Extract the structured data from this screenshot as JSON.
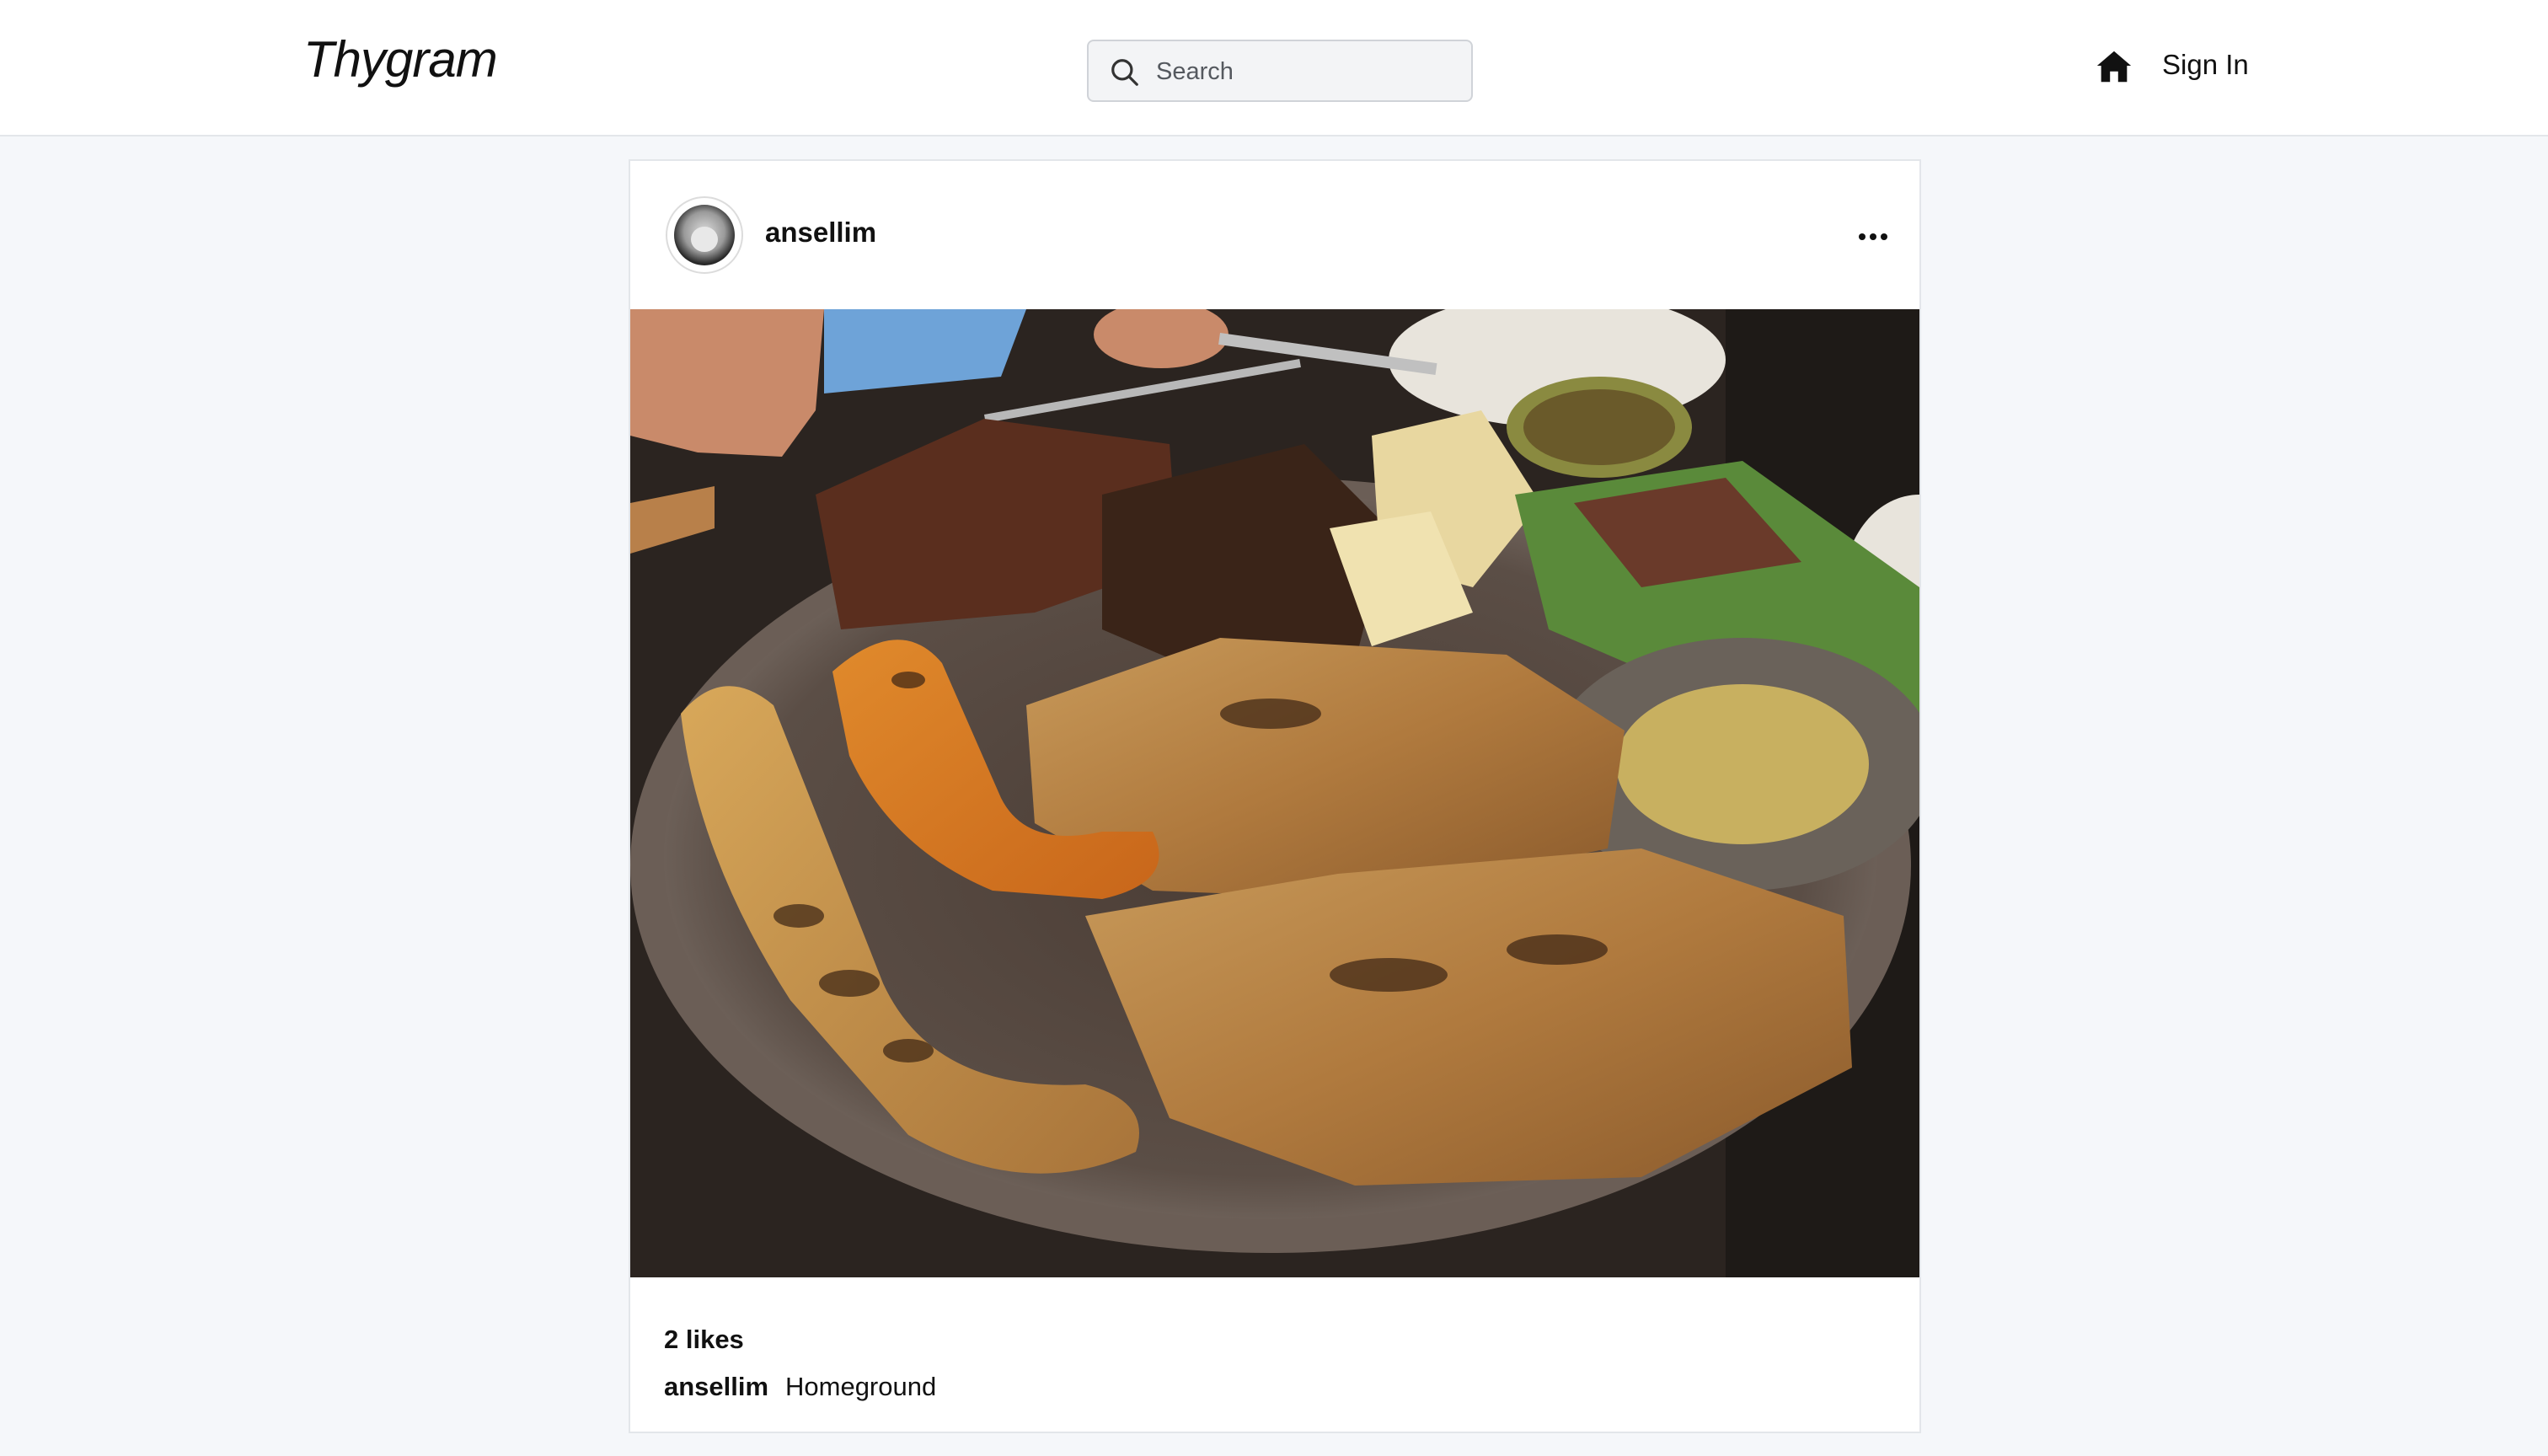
{
  "header": {
    "logo": "Thygram",
    "search": {
      "placeholder": "Search",
      "value": ""
    },
    "home_icon": "home-icon",
    "signin_label": "Sign In"
  },
  "post": {
    "username": "ansellim",
    "avatar_icon": "user-avatar",
    "more_icon": "more-horizontal-icon",
    "likes": "2 likes",
    "caption": {
      "username": "ansellim",
      "text": "Homeground"
    }
  },
  "colors": {
    "page_background": "#f5f7fa",
    "card_background": "#ffffff",
    "border": "#e3e6ea",
    "text": "#111111"
  }
}
